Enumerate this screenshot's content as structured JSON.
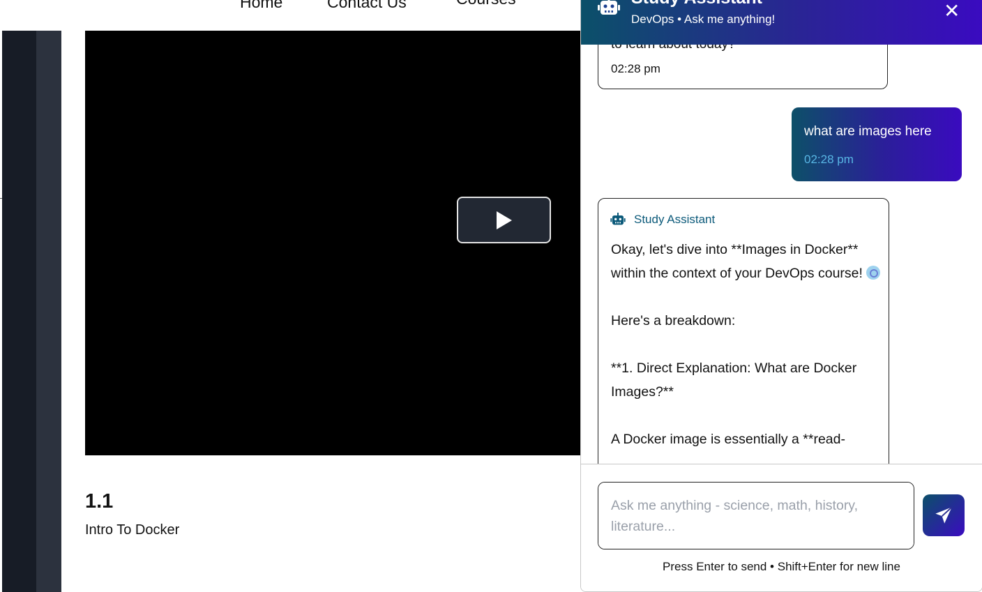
{
  "nav": {
    "home": "Home",
    "contact": "Contact Us",
    "courses": "Courses"
  },
  "lesson": {
    "number": "1.1",
    "title": "Intro To Docker"
  },
  "chat": {
    "title": "Study Assistant",
    "subtitle": "DevOps • Ask me anything!",
    "close_label": "✕",
    "prev_message": {
      "text": "to learn about today?",
      "time": "02:28 pm"
    },
    "user_message": {
      "text": "what are images here",
      "time": "02:28 pm"
    },
    "bot_message": {
      "sender": "Study Assistant",
      "para1": "Okay, let's dive into **Images in Docker** within the context of your DevOps course! ",
      "para2": "Here's a breakdown:",
      "para3": "**1. Direct Explanation: What are Docker Images?**",
      "para4": "A Docker image is essentially a **read-"
    },
    "input_placeholder": "Ask me anything - science, math, history, literature...",
    "hint": "Press Enter to send • Shift+Enter for new line"
  },
  "colors": {
    "header_start": "#0b5069",
    "header_end": "#3a0bc0",
    "bot_name": "#0c5a7a",
    "user_time": "#58b6e4"
  }
}
